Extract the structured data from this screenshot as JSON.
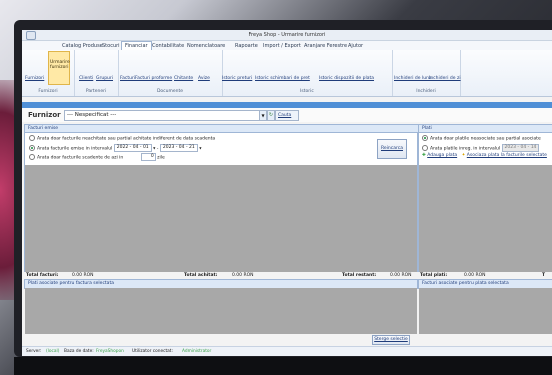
{
  "window": {
    "title": "Freya Shop - Urmarire furnizori"
  },
  "menu": [
    "Catalog Produse",
    "Stocuri",
    "Financiar",
    "Contabilitate",
    "Nomenclatoare",
    "Rapoarte",
    "Import / Export",
    "Aranjare Ferestre",
    "Ajutor"
  ],
  "ribbon": {
    "furnizori": {
      "items": [
        "Furnizori",
        "Urmarire furnizori"
      ],
      "label": "Furnizori"
    },
    "parteneri": {
      "items": [
        "Clienti",
        "Grupuri"
      ],
      "label": "Parteneri"
    },
    "documente": {
      "items": [
        "Facturi",
        "Facturi proforme",
        "Chitante",
        "Avize"
      ],
      "label": "Documente"
    },
    "istoric": {
      "items": [
        "Istoric preturi",
        "Istoric schimbari de pret",
        "Istoric dispozitii de plata"
      ],
      "label": "Istoric"
    },
    "inchideri": {
      "items": [
        "Inchideri de luna",
        "Inchideri de zi"
      ],
      "label": "Inchideri"
    }
  },
  "furnizor_bar": {
    "label": "Furnizor",
    "value": "--- Nespecificat ---",
    "search_label": "Cauta"
  },
  "facturi": {
    "title": "Facturi emise",
    "options": [
      "Arata doar facturile neachitate sau partial achitate indiferent de data scadenta",
      "Arata facturile emise in intervalul",
      "Arata doar facturile scadente de azi in"
    ],
    "date_from": "2022 - 04 - 01",
    "date_to": "2023 - 04 - 21",
    "days_value": "0",
    "days_unit": "zile",
    "refresh_label": "Reincarca"
  },
  "plati": {
    "title": "Plati",
    "options": [
      "Arata doar platile neasociate sau partial asociate",
      "Arata platile inreg. in intervalul"
    ],
    "date_from": "2023 - 04 - 14",
    "add_label": "Adauga plata",
    "assoc_label": "Asociaza plata la facturile selectate"
  },
  "totals": {
    "facturi_label": "Total facturi:",
    "facturi_value": "0.00 RON",
    "achitat_label": "Total achitat:",
    "achitat_value": "0.00 RON",
    "restant_label": "Total restant:",
    "restant_value": "0.00 RON",
    "plati_label": "Total plati:",
    "plati_value": "0.00 RON",
    "t_label": "T"
  },
  "sub_panels": {
    "left": "Plati asociate pentru factura selectata",
    "right": "Facturi asociate pentru plata selectata",
    "delete_label": "Sterge selectie"
  },
  "status": {
    "server_label": "Server:",
    "server_value": "(local)",
    "db_label": "Baza de date:",
    "db_value": "FreyaShopon",
    "user_label": "Utilizator conectat:",
    "user_value": "Administrator"
  }
}
